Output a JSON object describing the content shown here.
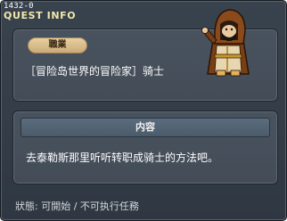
{
  "window": {
    "quest_id": "1432-0",
    "title": "QUEST INFO"
  },
  "job_panel": {
    "badge_label": "職業",
    "job_text": "［冒险岛世界的冒险家］骑士",
    "avatar_icon": "hooded-knight-character-icon"
  },
  "content_panel": {
    "header_label": "内容",
    "body_text": "去泰勒斯那里听听转职成骑士的方法吧。"
  },
  "status_text": "狀態: 可開始 / 不可执行任務",
  "colors": {
    "window_bg": "#35404a",
    "title": "#f1e7a7",
    "badge_bg": "#dcc08f",
    "header_bg": "#54667a"
  }
}
